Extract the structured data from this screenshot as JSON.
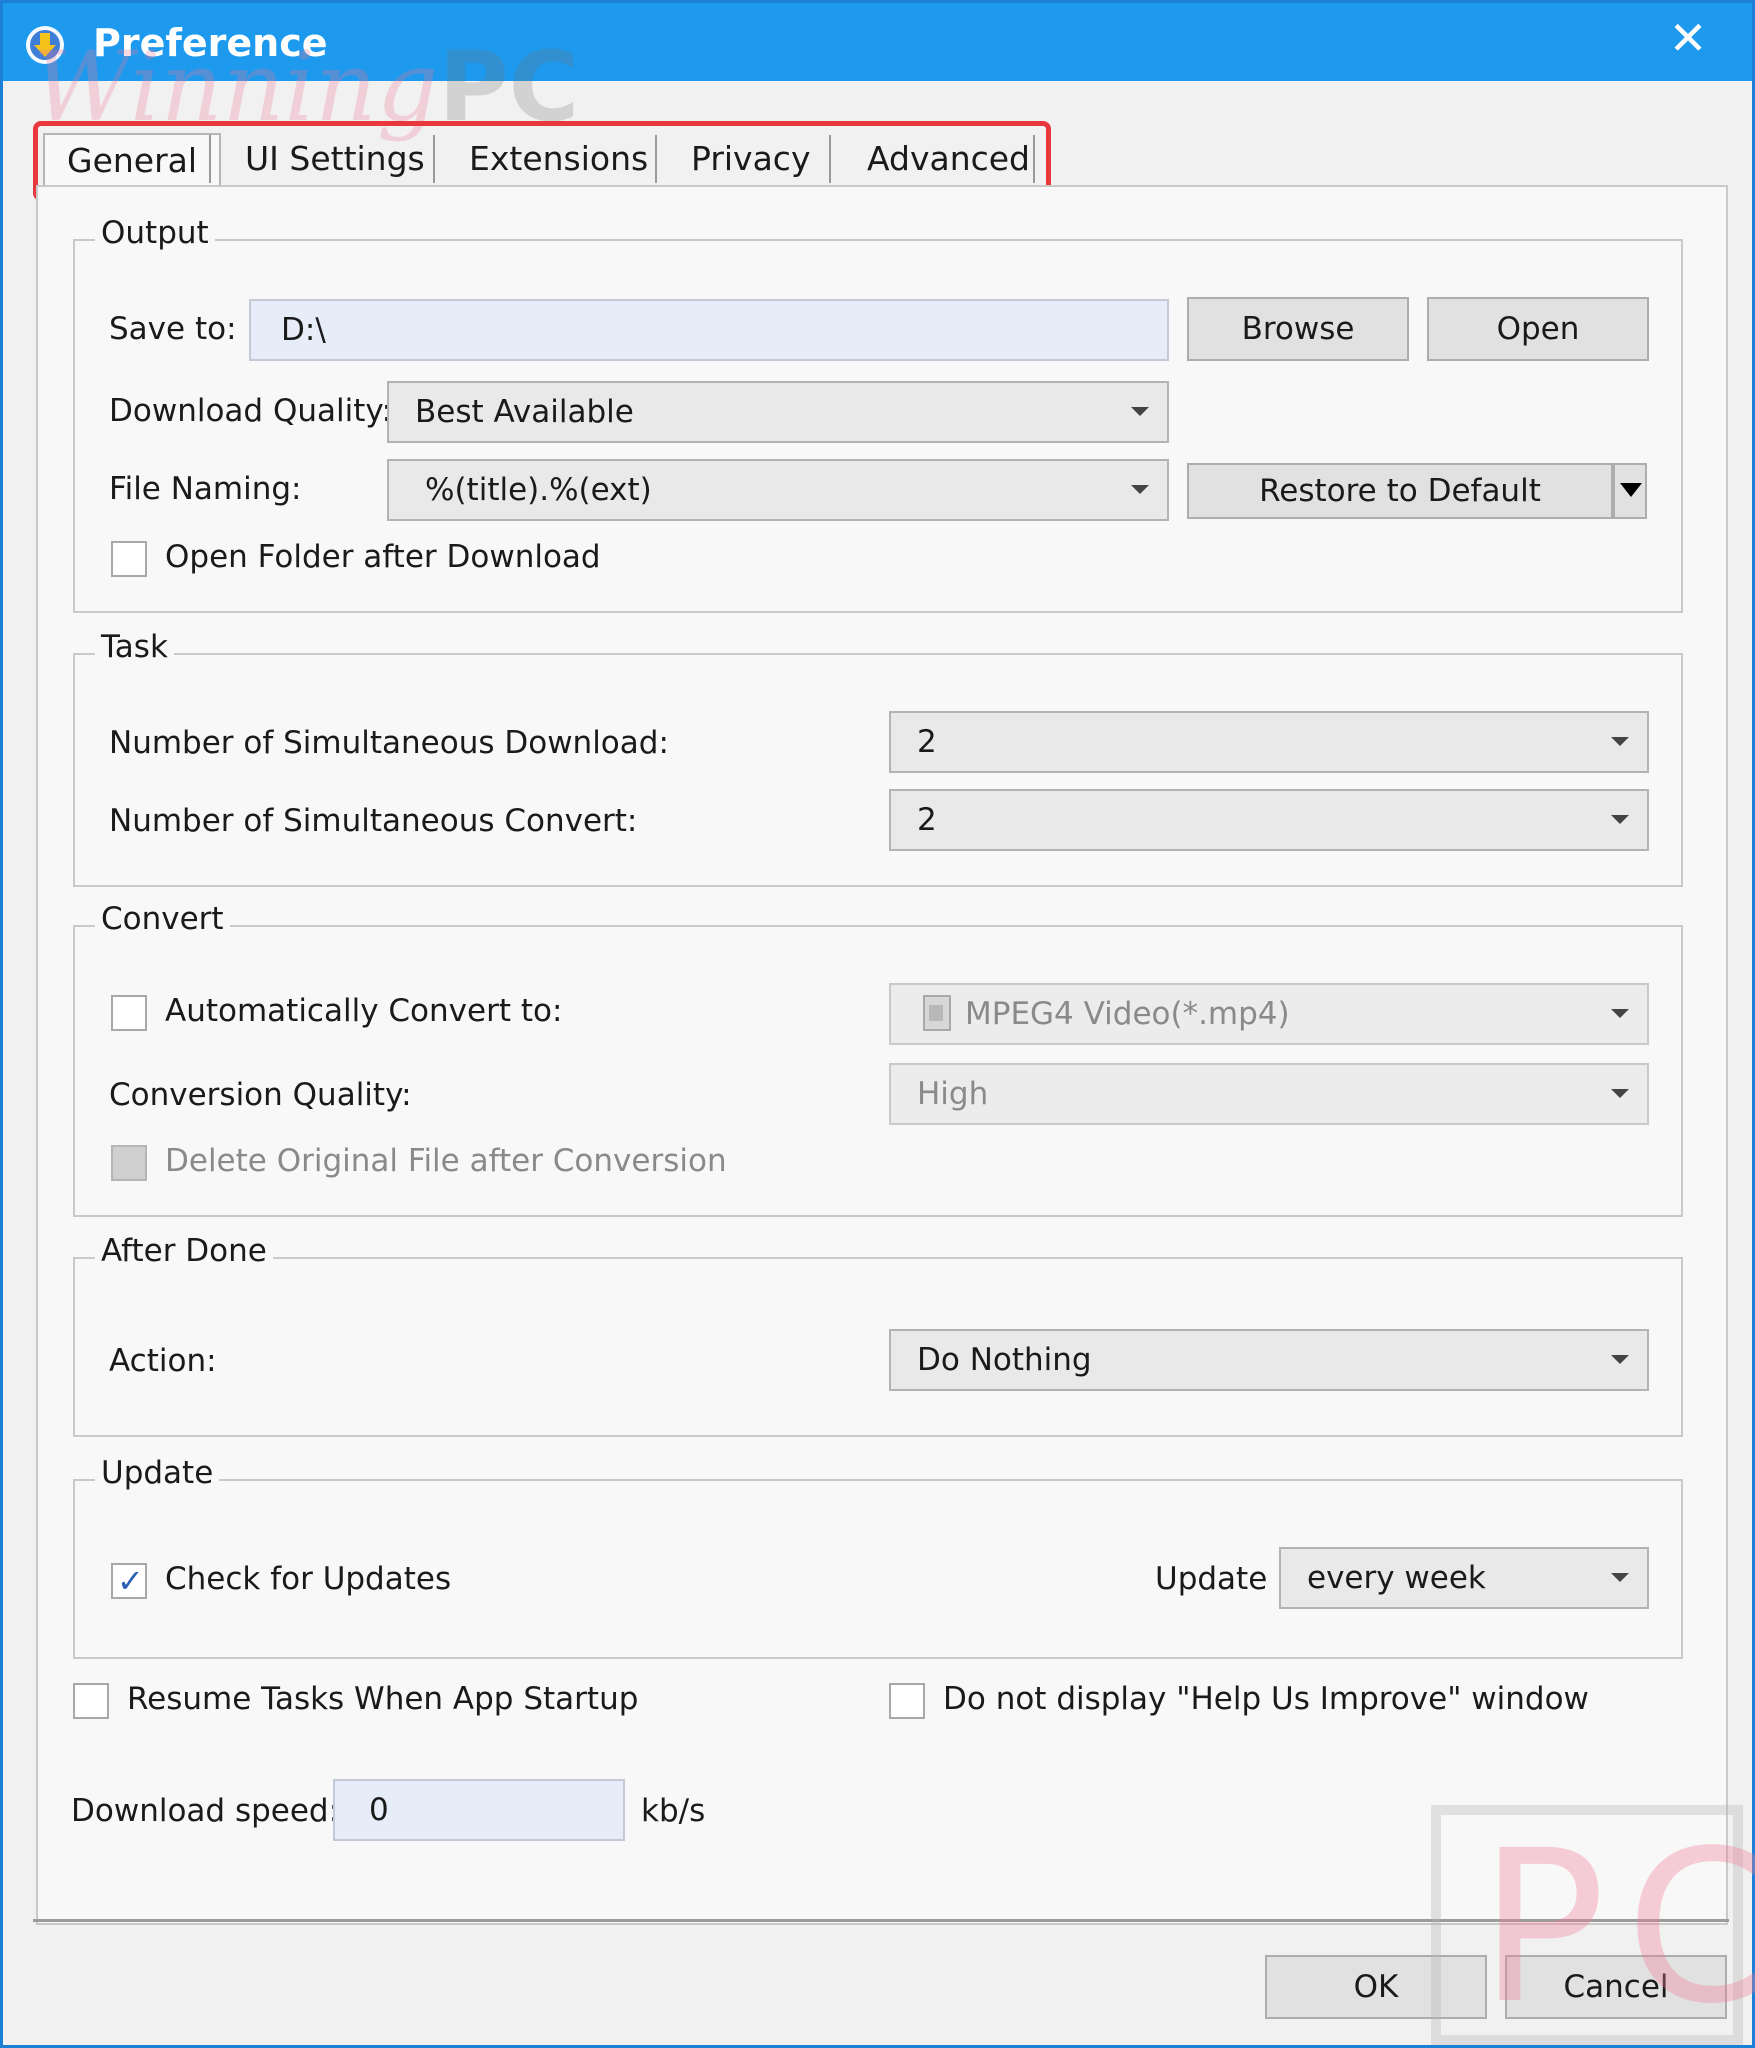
{
  "window": {
    "title": "Preference"
  },
  "watermark": {
    "top_script": "Winning",
    "top_bold": "PC",
    "corner": "PC"
  },
  "tabs": [
    {
      "label": "General",
      "active": true
    },
    {
      "label": "UI Settings",
      "active": false
    },
    {
      "label": "Extensions",
      "active": false
    },
    {
      "label": "Privacy",
      "active": false
    },
    {
      "label": "Advanced",
      "active": false
    }
  ],
  "output": {
    "title": "Output",
    "save_to_label": "Save to:",
    "save_to_value": "D:\\",
    "browse_label": "Browse",
    "open_label": "Open",
    "quality_label": "Download Quality:",
    "quality_value": "Best Available",
    "naming_label": "File Naming:",
    "naming_value": "%(title).%(ext)",
    "restore_label": "Restore to Default",
    "open_folder_label": "Open Folder after Download",
    "open_folder_checked": false
  },
  "task": {
    "title": "Task",
    "sim_download_label": "Number of Simultaneous Download:",
    "sim_download_value": "2",
    "sim_convert_label": "Number of Simultaneous Convert:",
    "sim_convert_value": "2"
  },
  "convert": {
    "title": "Convert",
    "auto_convert_label": "Automatically Convert to:",
    "auto_convert_checked": false,
    "format_value": "MPEG4 Video(*.mp4)",
    "quality_label": "Conversion Quality:",
    "quality_value": "High",
    "delete_original_label": "Delete Original File after Conversion"
  },
  "after_done": {
    "title": "After Done",
    "action_label": "Action:",
    "action_value": "Do Nothing"
  },
  "update": {
    "title": "Update",
    "check_label": "Check for Updates",
    "check_checked": true,
    "freq_label": "Update",
    "freq_value": "every week"
  },
  "misc": {
    "resume_label": "Resume Tasks When App Startup",
    "help_label": "Do not display \"Help Us Improve\" window",
    "speed_label": "Download speed:",
    "speed_value": "0",
    "speed_unit": "kb/s"
  },
  "footer": {
    "ok_label": "OK",
    "cancel_label": "Cancel"
  },
  "colors": {
    "titlebar": "#1d99ee",
    "highlight": "#e8383d",
    "check": "#2a5fb5"
  }
}
